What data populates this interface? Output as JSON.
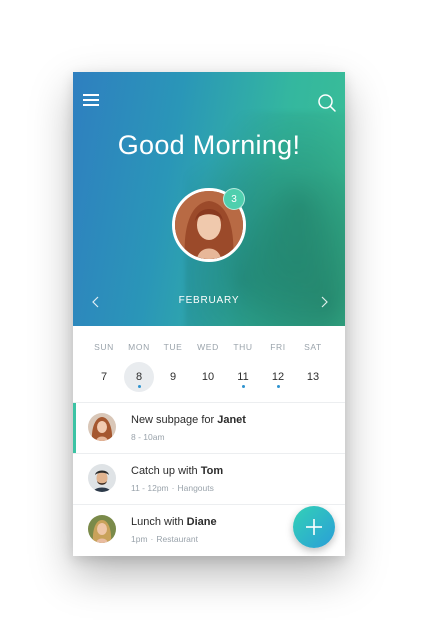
{
  "header": {
    "greeting": "Good Morning!",
    "notification_count": "3",
    "month": "FEBRUARY",
    "menu_icon": "hamburger-menu-icon",
    "search_icon": "search-icon",
    "prev_icon": "chevron-left-icon",
    "next_icon": "chevron-right-icon",
    "gradient_start": "#2f7fc0",
    "gradient_end": "#3bbf94"
  },
  "week": {
    "days": [
      {
        "name": "SUN",
        "num": "7",
        "selected": false,
        "has_event": false
      },
      {
        "name": "MON",
        "num": "8",
        "selected": true,
        "has_event": true
      },
      {
        "name": "TUE",
        "num": "9",
        "selected": false,
        "has_event": false
      },
      {
        "name": "WED",
        "num": "10",
        "selected": false,
        "has_event": false
      },
      {
        "name": "THU",
        "num": "11",
        "selected": false,
        "has_event": true
      },
      {
        "name": "FRI",
        "num": "12",
        "selected": false,
        "has_event": true
      },
      {
        "name": "SAT",
        "num": "13",
        "selected": false,
        "has_event": false
      }
    ],
    "event_dot_color": "#2f93cf"
  },
  "events": [
    {
      "title_prefix": "New subpage for ",
      "title_person": "Janet",
      "time": "8 - 10am",
      "location": "",
      "active": true
    },
    {
      "title_prefix": "Catch up with ",
      "title_person": "Tom",
      "time": "11 - 12pm",
      "location": "Hangouts",
      "active": false
    },
    {
      "title_prefix": "Lunch with ",
      "title_person": "Diane",
      "time": "1pm",
      "location": "Restaurant",
      "active": false
    }
  ],
  "fab": {
    "icon": "plus-icon",
    "color_start": "#33d1b6",
    "color_end": "#2a9ed8"
  },
  "accent_color": "#3cc3a4"
}
